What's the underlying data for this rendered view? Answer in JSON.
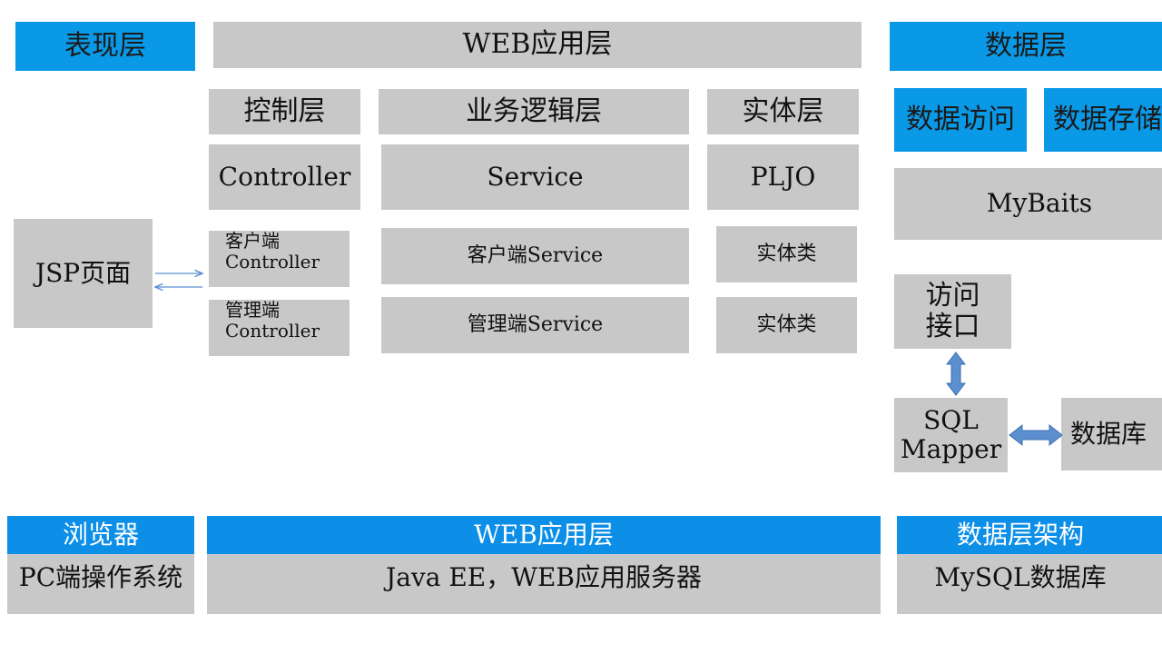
{
  "top_row": {
    "presentation_layer": "表现层",
    "web_layer": "WEB应用层",
    "data_layer": "数据层"
  },
  "web": {
    "control_layer": "控制层",
    "business_layer": "业务逻辑层",
    "entity_layer": "实体层",
    "controller": "Controller",
    "service": "Service",
    "pljo": "PLJO",
    "client_controller": [
      "客户端",
      "Controller"
    ],
    "admin_controller": [
      "管理端",
      "Controller"
    ],
    "client_service": "客户端Service",
    "admin_service": "管理端Service",
    "entity_class_1": "实体类",
    "entity_class_2": "实体类"
  },
  "presentation": {
    "jsp_page": "JSP页面"
  },
  "data": {
    "data_access": "数据访问",
    "data_storage": "数据存储",
    "mybatis": "MyBaits",
    "access_interface": [
      "访问",
      "接口"
    ],
    "sql_mapper": [
      "SQL",
      "Mapper"
    ],
    "database": "数据库"
  },
  "bottom_row": {
    "browser": "浏览器",
    "web_layer": "WEB应用层",
    "data_arch": "数据层架构",
    "os": "PC端操作系统",
    "server": "Java EE，WEB应用服务器",
    "mysql": "MySQL数据库"
  },
  "colors": {
    "gray_box": "#c8c8c8",
    "blue_box": "#0a99e6",
    "blue_bar": "#0d8fe8",
    "arrow": "#5b8fd0"
  }
}
